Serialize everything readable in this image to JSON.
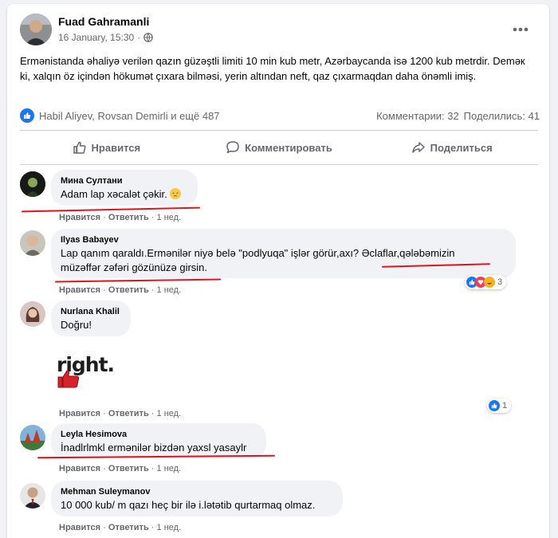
{
  "post": {
    "author": "Fuad Gahramanli",
    "date": "16 January, 15:30",
    "privacy_sep": "·",
    "text": "Ermənistanda əhaliyə verilən   qazın güzəştli limiti 10 min kub metr, Azərbaycanda isə 1200 kub metrdir.  Deməк ki, xalqın öz içindən hökumət çıxara bilməsi, yerin altından neft, qaz çıxarmaqdan daha önəmli imiş.",
    "reactions_text": "Habil Aliyev, Rovsan Demirli и ещё 487",
    "comments_count": "Комментарии: 32",
    "shares_count": "Поделились: 41",
    "more_label": "•••"
  },
  "actions": {
    "like": "Нравится",
    "comment": "Комментировать",
    "share": "Поделиться"
  },
  "comment_actions": {
    "like": "Нравится",
    "reply": "Ответить",
    "time": "1 нед.",
    "dot": "·"
  },
  "comments": [
    {
      "name": "Мина Султани",
      "text": "Adam lap xəcalət çəkir."
    },
    {
      "name": "Ilyas Babayev",
      "text": "Lap qanım qaraldı.Ermənilər niyə belə \"podlyuqa\" işlər görür,axı? Əclaflar,qələbəmizin müzəffər zəfəri gözünüzə girsin.",
      "reactions": "3"
    },
    {
      "name": "Nurlana Khalil",
      "text": "Doğru!",
      "sticker": "right.",
      "reactions": "1"
    },
    {
      "name": "Leyla Hesimova",
      "text": "İnadlrlmkl ermənilər bizdən yaxsl yasaylr"
    },
    {
      "name": "Mehman Suleymanov",
      "text": "10 000 kub/ m qazı heç bir ilə i.lətətib qurtarmaq olmaz."
    }
  ],
  "colors": {
    "facebook_blue": "#1877f2",
    "annotation_red": "#e0141e",
    "muted_text": "#65676b",
    "bubble_bg": "#f0f2f5"
  }
}
